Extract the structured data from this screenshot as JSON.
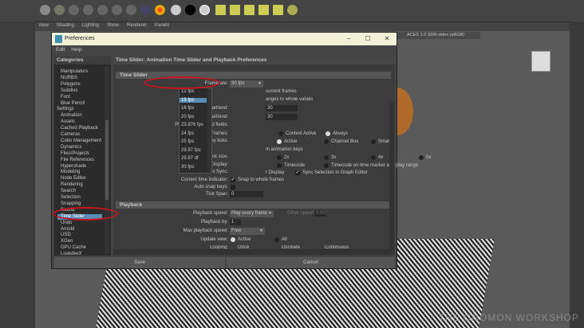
{
  "maya": {
    "panel_menu": [
      "View",
      "Shading",
      "Lighting",
      "Show",
      "Renderer",
      "Panels"
    ],
    "color_space": "ACES 1.0 SDR-video (sRGB)",
    "watermark": "THE GNOMON WORKSHOP"
  },
  "dialog": {
    "title": "Preferences",
    "menu": [
      "Edit",
      "Help"
    ],
    "window_buttons": {
      "minimize": "–",
      "maximize": "☐",
      "close": "✕"
    },
    "categories_header": "Categories",
    "categories": [
      {
        "label": "Manipulators"
      },
      {
        "label": "NURBS"
      },
      {
        "label": "Polygons"
      },
      {
        "label": "Subdivs"
      },
      {
        "label": "Font"
      },
      {
        "label": "Blue Pencil"
      },
      {
        "label": "Settings",
        "top": true
      },
      {
        "label": "Animation"
      },
      {
        "label": "Assets"
      },
      {
        "label": "Cached Playback"
      },
      {
        "label": "Cameras"
      },
      {
        "label": "Color Management"
      },
      {
        "label": "Dynamics"
      },
      {
        "label": "Files/Projects"
      },
      {
        "label": "File References"
      },
      {
        "label": "Hypershade"
      },
      {
        "label": "Modeling"
      },
      {
        "label": "Node Editor"
      },
      {
        "label": "Rendering"
      },
      {
        "label": "Search"
      },
      {
        "label": "Selection"
      },
      {
        "label": "Snapping"
      },
      {
        "label": "Sound"
      },
      {
        "label": "Time Slider",
        "selected": true
      },
      {
        "label": "Undo"
      },
      {
        "label": "Arnold"
      },
      {
        "label": "USD"
      },
      {
        "label": "XGen"
      },
      {
        "label": "GPU Cache"
      },
      {
        "label": "LookdevX"
      }
    ],
    "page_title": "Time Slider: Animation Time Slider and Playback Preferences",
    "time_slider": {
      "header": "Time Slider",
      "framerate_label": "Framerate:",
      "framerate_value": "30 fps",
      "framerate_options": [
        "12 fps",
        "15 fps",
        "16 fps",
        "20 fps",
        "23.976 fps",
        "24 fps",
        "25 fps",
        "29.97 fps",
        "29.97 df",
        "30 fps"
      ],
      "highlighted_option": "15 fps",
      "partial_1": "current frames",
      "partial_2": "anges to whole values",
      "playback_start_end_label": "Playback start/end:",
      "playback_start_end_value": "30",
      "animation_start_end_label": "Animation start/end:",
      "animation_start_end_value": "30",
      "playback_fields_label": "Playback start/end fields:",
      "blue_pencil_label": "Blue Pencil Frames:",
      "blue_pencil_opts": [
        "Context Active",
        "Always"
      ],
      "key_ticks_label": "Key ticks:",
      "key_ticks_opts": [
        "Active",
        "Channel Box",
        "Smart"
      ],
      "key_ticks_partial": "m animation keys",
      "key_tick_size_label": "Key tick size:",
      "key_tick_size_opts": [
        "2x",
        "3x",
        "4x",
        "5x"
      ],
      "time_display_label": "Time Display:",
      "time_display_opts": [
        "Timecode",
        "Timecode on time marker and play range"
      ],
      "channel_box_sync_label": "Channel Box Sync:",
      "channel_box_partial": "r Display",
      "sync_graph_editor": "Sync Selection in Graph Editor",
      "current_time_label": "Current time indicator:",
      "snap_whole": "Snap to whole frames",
      "auto_snap_label": "Auto snap keys:",
      "tick_span_label": "Tick Span:",
      "tick_span_value": "0"
    },
    "playback": {
      "header": "Playback",
      "speed_label": "Playback speed:",
      "speed_value": "Play every frame",
      "other_speed_label": "Other speed:",
      "other_speed_value": "0.00",
      "by_label": "Playback by:",
      "by_value": "1",
      "max_label": "Max playback speed:",
      "max_value": "Free",
      "update_label": "Update view:",
      "update_opts": [
        "Active",
        "All"
      ],
      "looping_label": "Looping:",
      "looping_opts": [
        "Once",
        "Oscillate",
        "Continuous"
      ]
    },
    "save": "Save",
    "cancel": "Cancel"
  },
  "colors": {
    "annotation": "#c8141e",
    "selection": "#5a8db5",
    "titlebar": "#f3f0d8"
  }
}
